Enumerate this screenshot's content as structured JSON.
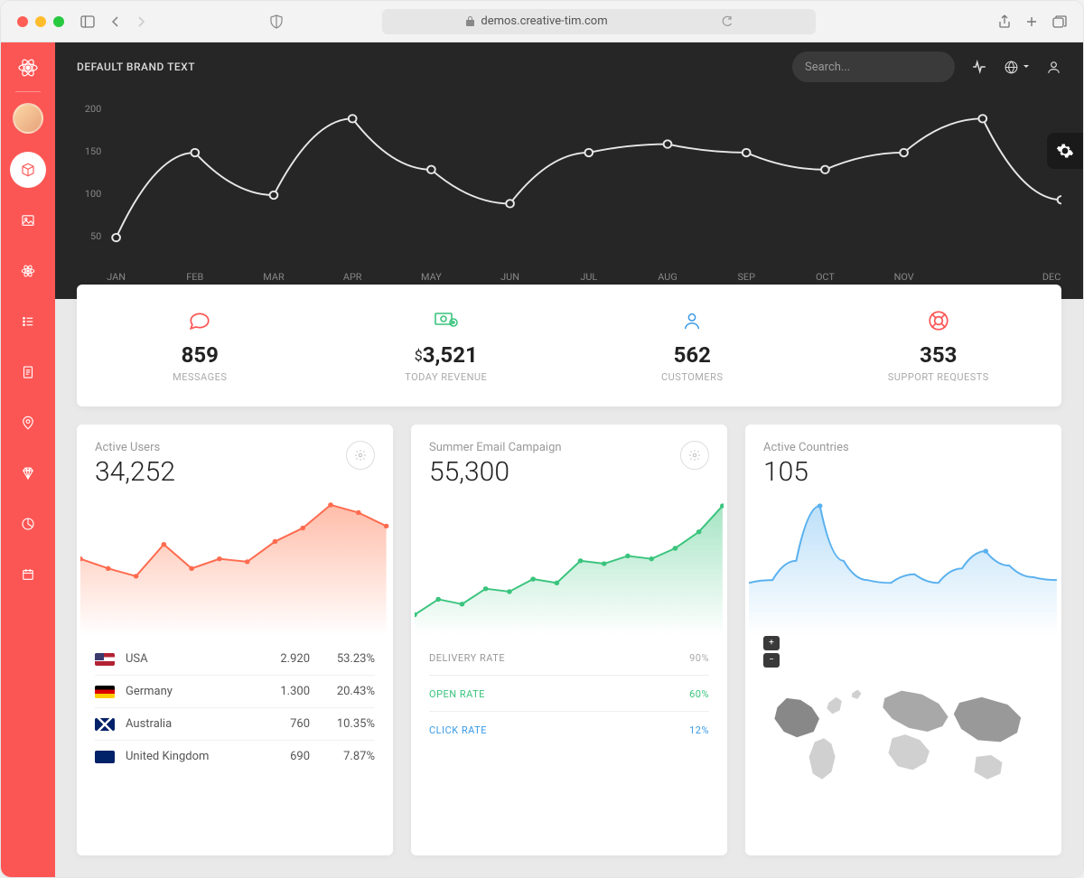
{
  "browser": {
    "url": "demos.creative-tim.com"
  },
  "header": {
    "brand": "DEFAULT BRAND TEXT",
    "search_placeholder": "Search..."
  },
  "stats": {
    "messages": {
      "value": "859",
      "label": "MESSAGES"
    },
    "revenue": {
      "prefix": "$",
      "value": "3,521",
      "label": "TODAY REVENUE"
    },
    "customers": {
      "value": "562",
      "label": "CUSTOMERS"
    },
    "support": {
      "value": "353",
      "label": "SUPPORT REQUESTS"
    }
  },
  "cards": {
    "active_users": {
      "title": "Active Users",
      "value": "34,252",
      "rows": [
        {
          "country": "USA",
          "num": "2.920",
          "pct": "53.23%"
        },
        {
          "country": "Germany",
          "num": "1.300",
          "pct": "20.43%"
        },
        {
          "country": "Australia",
          "num": "760",
          "pct": "10.35%"
        },
        {
          "country": "United Kingdom",
          "num": "690",
          "pct": "7.87%"
        }
      ]
    },
    "campaign": {
      "title": "Summer Email Campaign",
      "value": "55,300",
      "rates": [
        {
          "label": "DELIVERY RATE",
          "value": "90%"
        },
        {
          "label": "OPEN RATE",
          "value": "60%"
        },
        {
          "label": "CLICK RATE",
          "value": "12%"
        }
      ]
    },
    "countries": {
      "title": "Active Countries",
      "value": "105"
    }
  },
  "chart_data": [
    {
      "type": "line",
      "title": "",
      "categories": [
        "JAN",
        "FEB",
        "MAR",
        "APR",
        "MAY",
        "JUN",
        "JUL",
        "AUG",
        "SEP",
        "OCT",
        "NOV",
        "DEC"
      ],
      "values": [
        50,
        150,
        100,
        190,
        130,
        90,
        150,
        160,
        150,
        130,
        150,
        190,
        95
      ],
      "ylim": [
        50,
        200
      ],
      "yticks": [
        50,
        100,
        150,
        200
      ],
      "grid": false
    },
    {
      "type": "area",
      "name": "Active Users",
      "color": "#ff6b4f",
      "x": [
        0,
        1,
        2,
        3,
        4,
        5,
        6,
        7,
        8,
        9,
        10,
        11
      ],
      "values": [
        62,
        55,
        50,
        70,
        55,
        62,
        60,
        72,
        80,
        95,
        90,
        82
      ]
    },
    {
      "type": "area",
      "name": "Summer Email Campaign",
      "color": "#3ac47d",
      "x": [
        0,
        1,
        2,
        3,
        4,
        5,
        6,
        7,
        8,
        9,
        10,
        11,
        12,
        13
      ],
      "values": [
        20,
        32,
        28,
        40,
        38,
        48,
        45,
        62,
        60,
        66,
        64,
        72,
        85,
        100
      ]
    },
    {
      "type": "area",
      "name": "Active Countries",
      "color": "#5ab1ef",
      "x": [
        0,
        1,
        2,
        3,
        4,
        5,
        6,
        7,
        8,
        9,
        10,
        11,
        12,
        13
      ],
      "values": [
        40,
        42,
        55,
        90,
        55,
        42,
        40,
        46,
        40,
        50,
        62,
        52,
        44,
        42
      ]
    }
  ]
}
